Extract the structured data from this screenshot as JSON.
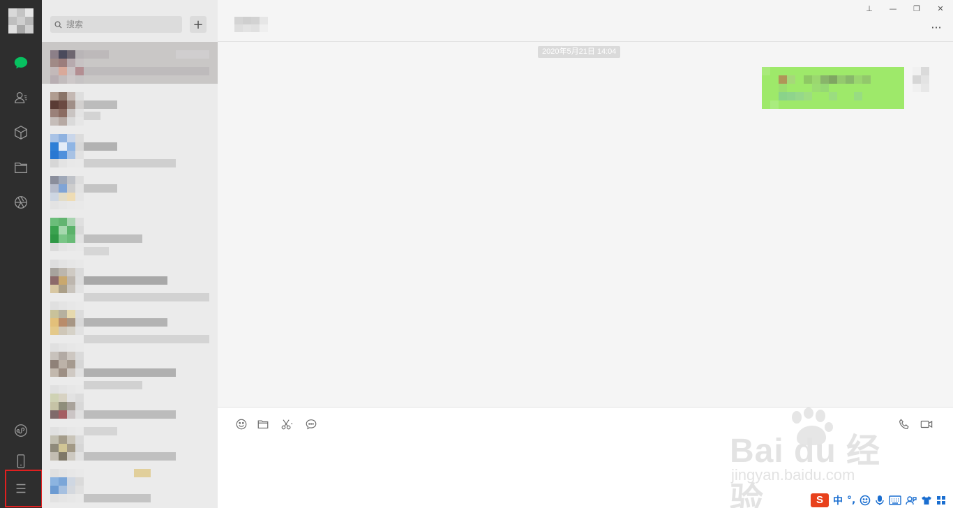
{
  "search": {
    "placeholder": "搜索"
  },
  "toolbar": {
    "add_label": "+"
  },
  "window": {
    "pin": "⊥",
    "minimize": "—",
    "maximize": "❐",
    "close": "✕",
    "more": "···"
  },
  "chat": {
    "timestamp": "2020年5月21日 14:04"
  },
  "watermark": {
    "brand": "Bai du 经验",
    "url": "jingyan.baidu.com"
  },
  "ime": {
    "logo": "S",
    "lang": "中",
    "punct": "°,"
  },
  "colors": {
    "sidebar": "#2e2e2e",
    "accent_green": "#07c160",
    "bubble": "#9eea6a",
    "highlight": "#e02020"
  }
}
